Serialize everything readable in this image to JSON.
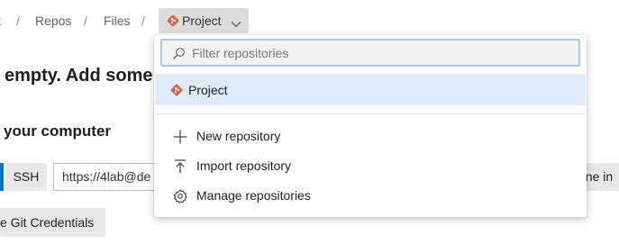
{
  "breadcrumb": {
    "items": [
      "t",
      "Repos",
      "Files"
    ],
    "separator": "/",
    "current": "Project"
  },
  "background": {
    "heading": "empty. Add some c",
    "subheading": "your computer",
    "ssh_label": "SSH",
    "clone_url": "https://4lab@de",
    "clone_button": "one in",
    "credentials_button": "e Git Credentials"
  },
  "dropdown": {
    "filter_placeholder": "Filter repositories",
    "filter_value": "",
    "repositories": [
      {
        "name": "Project",
        "icon": "git-repo-icon",
        "selected": true
      }
    ],
    "actions": [
      {
        "label": "New repository",
        "icon": "plus-icon"
      },
      {
        "label": "Import repository",
        "icon": "import-icon"
      },
      {
        "label": "Manage repositories",
        "icon": "gear-icon"
      }
    ]
  },
  "colors": {
    "git_brand": "#e05d44",
    "accent": "#0078d4",
    "selected_row": "#deecf9",
    "filter_border": "#a7c9e7"
  }
}
